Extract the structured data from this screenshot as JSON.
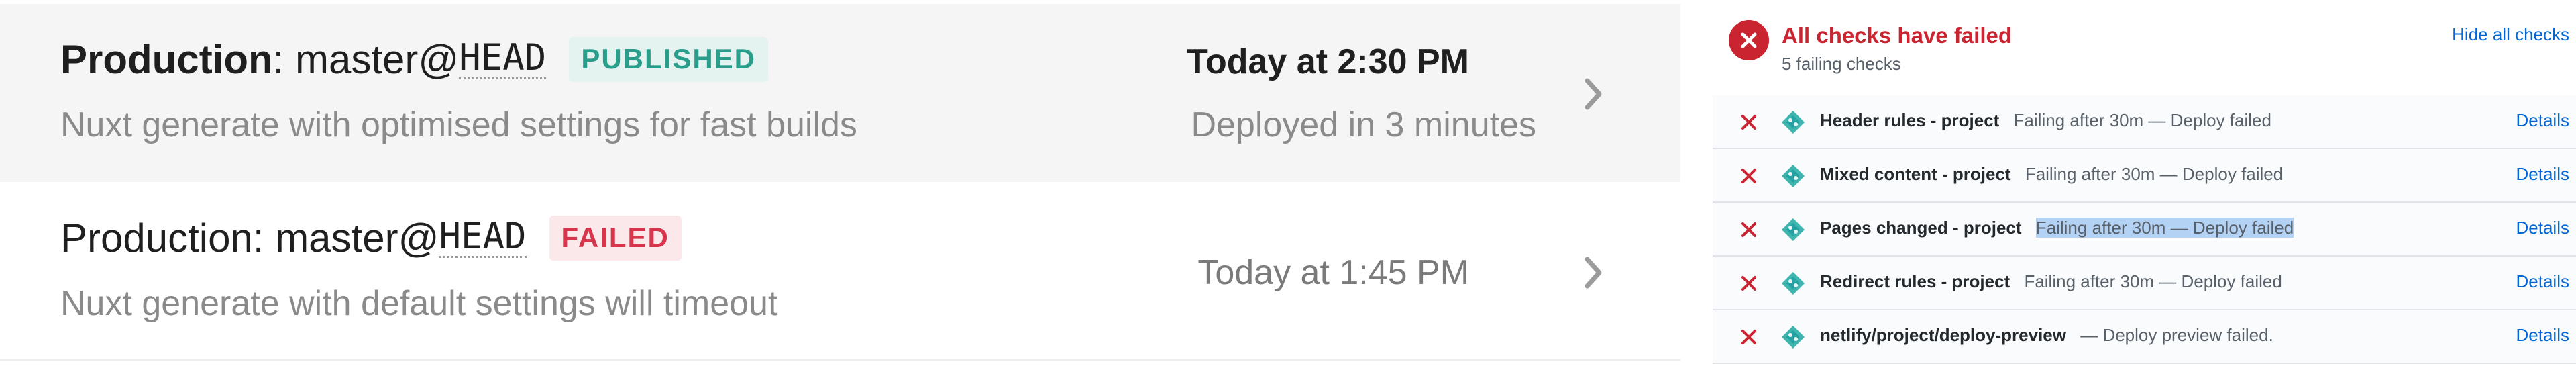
{
  "deploys": [
    {
      "context": "Production",
      "separator": ": ",
      "branch": "master@",
      "commit": "HEAD",
      "status": "PUBLISHED",
      "message": "Nuxt generate with optimised settings for fast builds",
      "time": "Today at 2:30 PM",
      "duration": "Deployed in 3 minutes"
    },
    {
      "context": "Production",
      "separator": ": ",
      "branch": "master@",
      "commit": "HEAD",
      "status": "FAILED",
      "message": "Nuxt generate with default settings will timeout",
      "time": "Today at 1:45 PM"
    }
  ],
  "checks": {
    "title": "All checks have failed",
    "subtitle": "5 failing checks",
    "hide_label": "Hide all checks",
    "items": [
      {
        "name": "Header rules - project",
        "description": "Failing after 30m — Deploy failed",
        "details_label": "Details"
      },
      {
        "name": "Mixed content - project",
        "description": "Failing after 30m — Deploy failed",
        "details_label": "Details"
      },
      {
        "name": "Pages changed - project",
        "description": "Failing after 30m — Deploy failed",
        "details_label": "Details"
      },
      {
        "name": "Redirect rules - project",
        "description": "Failing after 30m — Deploy failed",
        "details_label": "Details"
      },
      {
        "name": "netlify/project/deploy-preview",
        "description": "— Deploy preview failed.",
        "details_label": "Details"
      }
    ]
  },
  "colors": {
    "published_text": "#2a9d8b",
    "published_bg": "#e4f3f0",
    "failed_text": "#d6354b",
    "failed_bg": "#fbe8ea",
    "check_fail": "#cb2431",
    "link": "#0366d6",
    "selection": "#b4d2f4"
  },
  "icons": {
    "chevron": "chevron-right-icon",
    "fail": "x-icon",
    "app": "netlify-diamond-icon"
  }
}
